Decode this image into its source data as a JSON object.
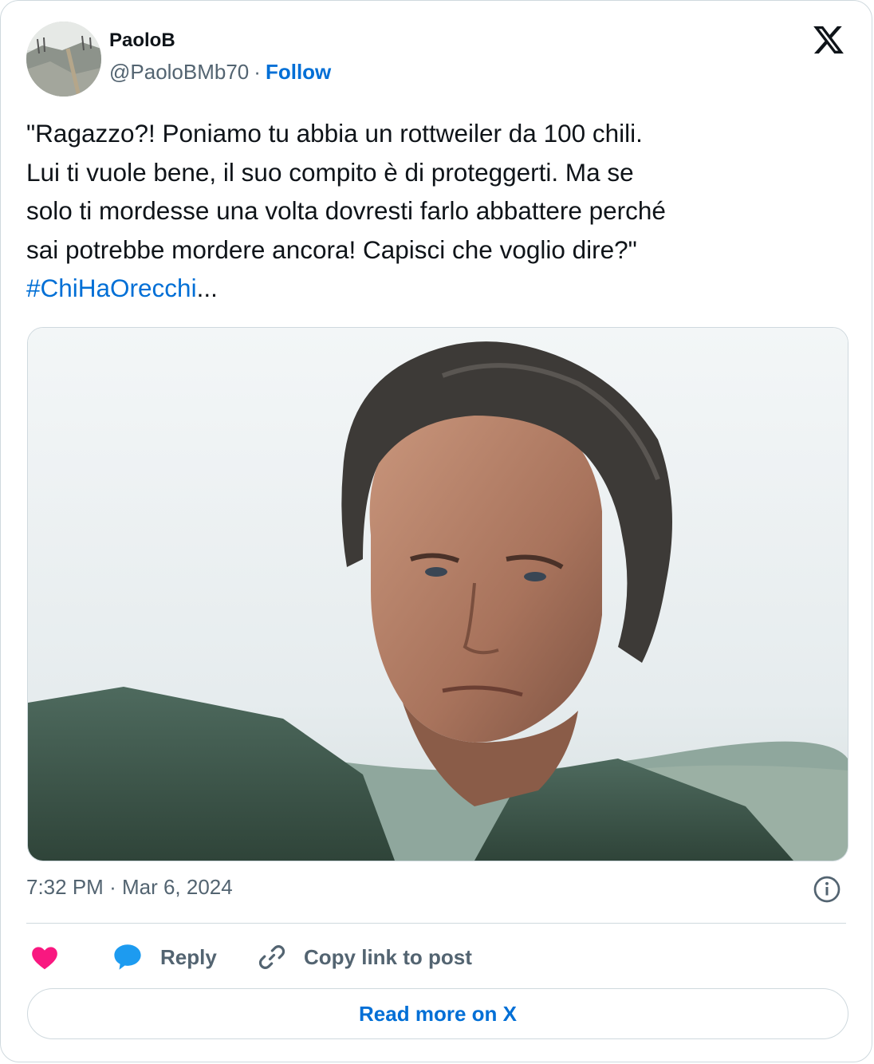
{
  "author": {
    "name": "PaoloB",
    "handle": "@PaoloBMb70",
    "separator": "·",
    "follow_label": "Follow"
  },
  "tweet": {
    "text_lines": [
      "\"Ragazzo?! Poniamo tu abbia un rottweiler da 100 chili.",
      "Lui ti vuole bene, il suo compito è di proteggerti. Ma se",
      "solo ti mordesse una volta dovresti farlo abbattere perché",
      "sai potrebbe mordere ancora! Capisci che voglio dire?\""
    ],
    "hashtag": "#ChiHaOrecchi",
    "ellipsis": "...",
    "time": "7:32 PM",
    "date": "Mar 6, 2024",
    "meta_separator": "·"
  },
  "actions": {
    "like_icon": "heart-icon",
    "reply_label": "Reply",
    "reply_icon": "speech-bubble-icon",
    "copy_label": "Copy link to post",
    "copy_icon": "link-icon"
  },
  "read_more_label": "Read more on X",
  "colors": {
    "link": "#006fd6",
    "muted": "#536471",
    "text": "#0f1419",
    "like": "#f91880",
    "reply_icon": "#1d9bf0",
    "border": "#cfd9de"
  }
}
